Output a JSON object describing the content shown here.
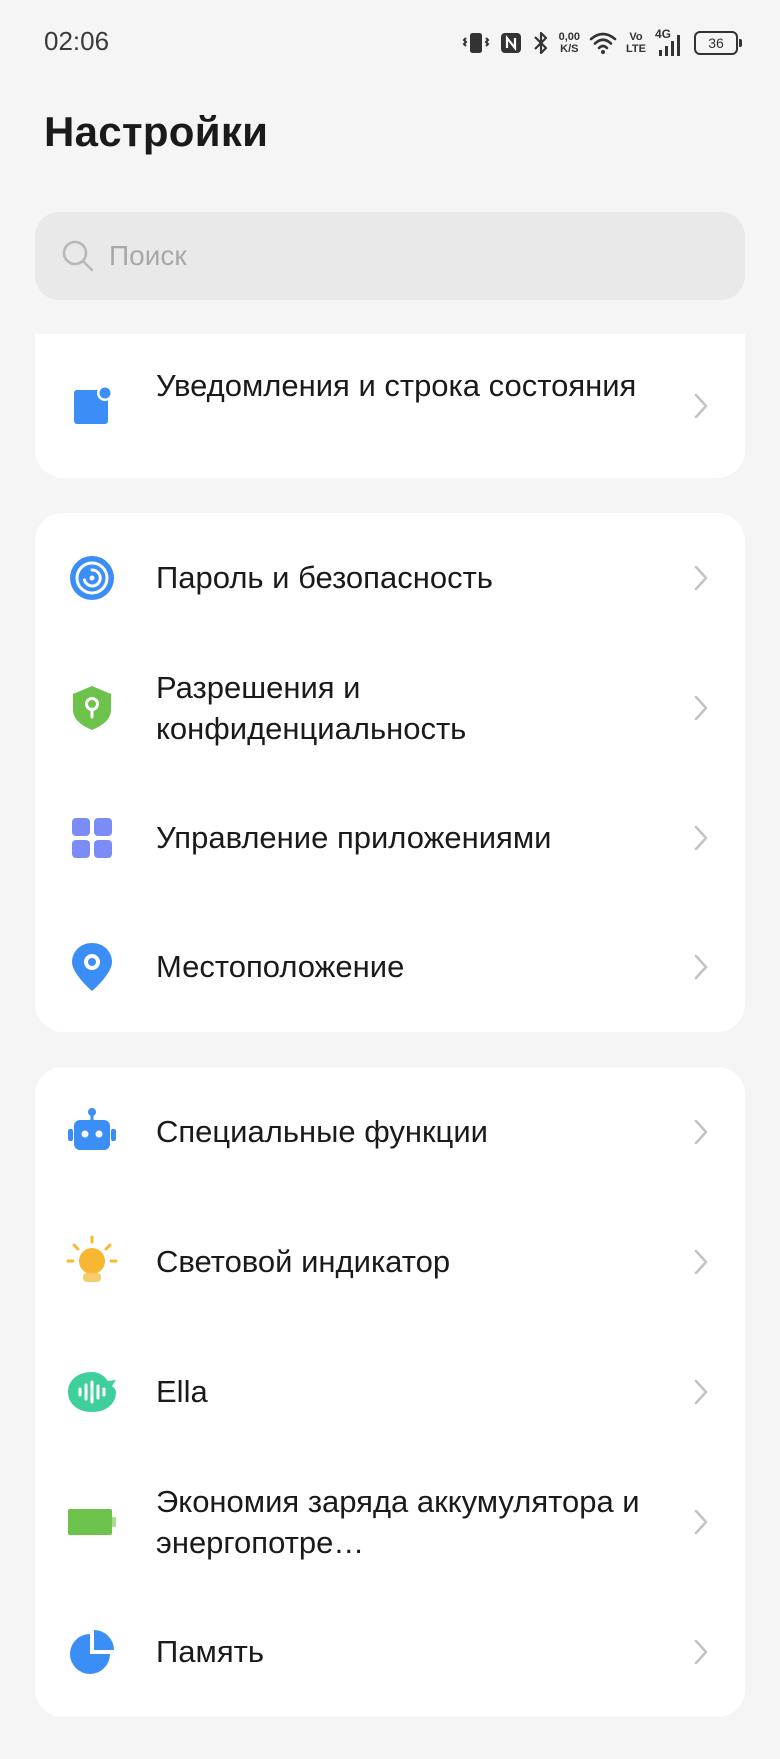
{
  "status_bar": {
    "time": "02:06",
    "net_speed_value": "0,00",
    "net_speed_unit": "K/S",
    "volte_top": "Vo",
    "volte_bottom": "LTE",
    "network": "4G",
    "battery": "36"
  },
  "header": {
    "title": "Настройки"
  },
  "search": {
    "placeholder": "Поиск"
  },
  "groups": [
    {
      "items": [
        {
          "label": "Уведомления и строка состояния",
          "icon": "notification-icon"
        }
      ]
    },
    {
      "items": [
        {
          "label": "Пароль и безопасность",
          "icon": "password-security-icon"
        },
        {
          "label": "Разрешения и конфиденциальность",
          "icon": "privacy-shield-icon"
        },
        {
          "label": "Управление приложениями",
          "icon": "app-grid-icon"
        },
        {
          "label": "Местоположение",
          "icon": "location-pin-icon"
        }
      ]
    },
    {
      "items": [
        {
          "label": "Специальные функции",
          "icon": "robot-icon"
        },
        {
          "label": "Световой индикатор",
          "icon": "light-bulb-icon"
        },
        {
          "label": "Ella",
          "icon": "ella-voice-icon"
        },
        {
          "label": "Экономия заряда аккумулятора и энергопотре…",
          "icon": "battery-icon"
        },
        {
          "label": "Память",
          "icon": "storage-pie-icon"
        }
      ]
    }
  ],
  "colors": {
    "background": "#f5f5f5",
    "card": "#ffffff",
    "search_bg": "#e9e9e9",
    "blue": "#3a8ef6",
    "green": "#6cc24a",
    "purple": "#7b8cf7",
    "orange": "#f7b733",
    "teal": "#3ecf9a"
  }
}
